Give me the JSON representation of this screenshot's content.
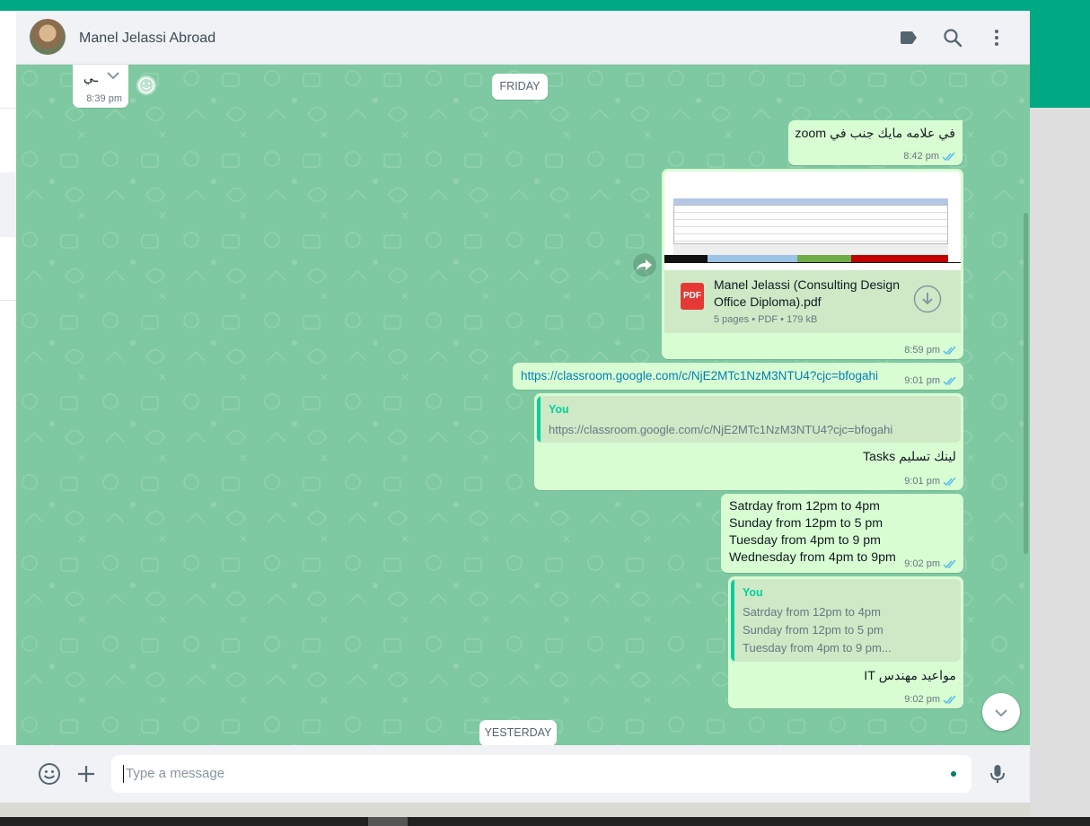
{
  "header": {
    "contact_name": "Manel Jelassi Abroad"
  },
  "date_separators": {
    "friday": "FRIDAY",
    "yesterday": "YESTERDAY"
  },
  "messages": {
    "incoming_partial": {
      "text": "ـي",
      "time": "8:39 pm"
    },
    "zoom": {
      "text": "في علامه مايك جنب في zoom",
      "time": "8:42 pm"
    },
    "pdf": {
      "file_name_line1": "Manel Jelassi (Consulting Design",
      "file_name_line2": "Office Diploma).pdf",
      "file_info": "5 pages • PDF • 179 kB",
      "badge": "PDF",
      "time": "8:59 pm"
    },
    "link": {
      "url": "https://classroom.google.com/c/NjE2MTc1NzM3NTU4?cjc=bfogahi",
      "time": "9:01 pm"
    },
    "reply_tasks": {
      "quote_author": "You",
      "quote_text": "https://classroom.google.com/c/NjE2MTc1NzM3NTU4?cjc=bfogahi",
      "text": "لينك تسليم Tasks",
      "time": "9:01 pm"
    },
    "schedule": {
      "lines": [
        "Satrday from 12pm to 4pm",
        "Sunday from 12pm to 5 pm",
        "Tuesday from 4pm to 9 pm",
        "Wednesday from 4pm to 9pm"
      ],
      "time": "9:02 pm"
    },
    "reply_it": {
      "quote_author": "You",
      "quote_lines": [
        "Satrday from 12pm to 4pm",
        "Sunday from 12pm to 5 pm",
        "Tuesday from 4pm to 9 pm..."
      ],
      "text": "مواعيد مهندس IT",
      "time": "9:02 pm"
    }
  },
  "composer": {
    "placeholder": "Type a message"
  },
  "colors": {
    "accent": "#00a884",
    "outgoing_bubble": "#d9fdd3",
    "chat_background": "#7fc9a2",
    "read_ticks": "#53bdeb",
    "link": "#027eb5"
  }
}
